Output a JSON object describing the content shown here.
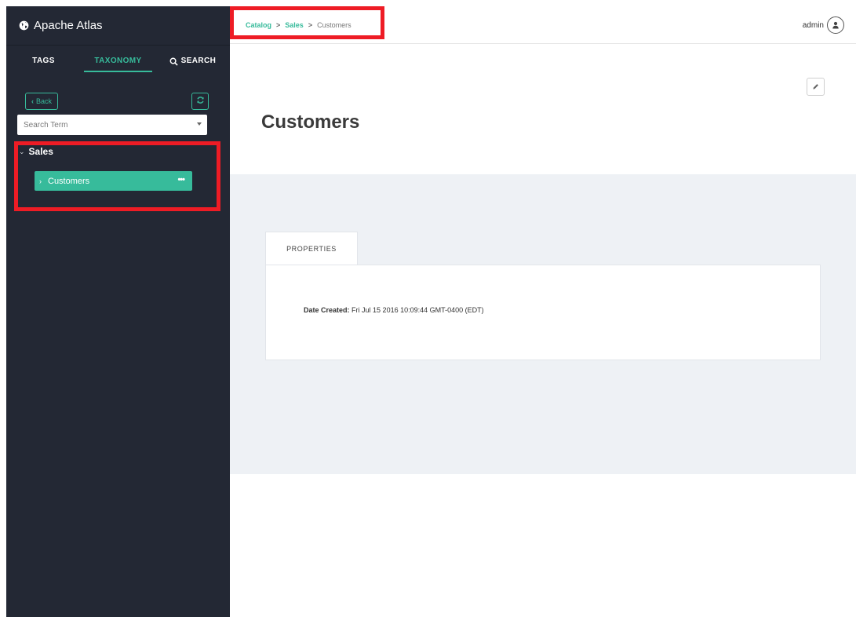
{
  "brand": {
    "title": "Apache Atlas"
  },
  "tabs": [
    {
      "label": "TAGS"
    },
    {
      "label": "TAXONOMY"
    },
    {
      "label": "SEARCH"
    }
  ],
  "sidebar": {
    "back_label": "Back",
    "search_placeholder": "Search Term",
    "tree": {
      "parent_label": "Sales",
      "child_label": "Customers"
    }
  },
  "breadcrumb": {
    "items": [
      "Catalog",
      "Sales",
      "Customers"
    ],
    "separator": ">"
  },
  "user": {
    "name": "admin"
  },
  "page": {
    "title": "Customers"
  },
  "properties": {
    "tab_label": "PROPERTIES",
    "date_created_label": "Date Created:",
    "date_created_value": "Fri Jul 15 2016 10:09:44 GMT-0400 (EDT)"
  },
  "colors": {
    "accent": "#37bb9b",
    "sidebar_bg": "#232834",
    "highlight": "#ee1c25",
    "content_bg": "#eef1f5"
  },
  "icons": [
    "globe-icon",
    "search-icon",
    "chevron-left-icon",
    "refresh-icon",
    "chevron-down-icon",
    "chevron-right-icon",
    "ellipsis-icon",
    "user-icon",
    "pencil-icon",
    "caret-down-icon"
  ]
}
